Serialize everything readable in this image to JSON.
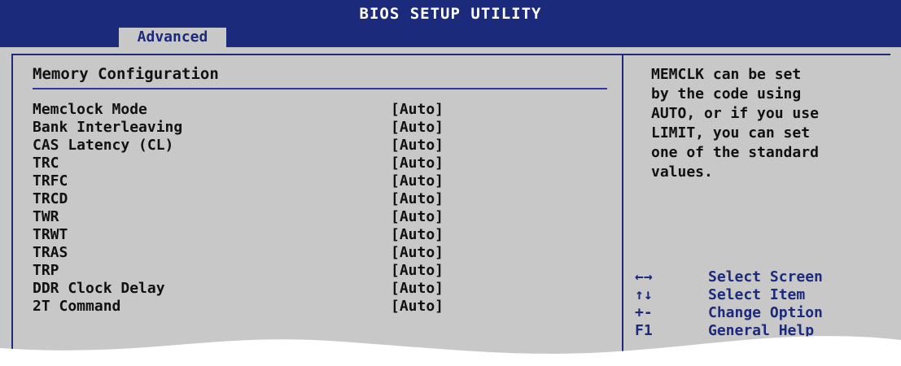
{
  "header": {
    "title": "BIOS SETUP UTILITY",
    "active_tab": "Advanced"
  },
  "main": {
    "section_title": "Memory Configuration",
    "items": [
      {
        "label": "Memclock Mode",
        "value": "[Auto]"
      },
      {
        "label": "Bank Interleaving",
        "value": "[Auto]"
      },
      {
        "label": "CAS Latency (CL)",
        "value": "[Auto]"
      },
      {
        "label": "TRC",
        "value": "[Auto]"
      },
      {
        "label": "TRFC",
        "value": "[Auto]"
      },
      {
        "label": "TRCD",
        "value": "[Auto]"
      },
      {
        "label": "TWR",
        "value": "[Auto]"
      },
      {
        "label": "TRWT",
        "value": "[Auto]"
      },
      {
        "label": "TRAS",
        "value": "[Auto]"
      },
      {
        "label": "TRP",
        "value": "[Auto]"
      },
      {
        "label": "DDR Clock Delay",
        "value": "[Auto]"
      },
      {
        "label": "2T Command",
        "value": "[Auto]"
      }
    ]
  },
  "help_panel": {
    "text": "MEMCLK can be set\nby the code using\nAUTO, or if you use\nLIMIT, you can set\none of the standard\nvalues."
  },
  "keys": [
    {
      "key": "←→",
      "desc": "Select Screen"
    },
    {
      "key": "↑↓",
      "desc": "Select Item"
    },
    {
      "key": "+-",
      "desc": "Change Option"
    },
    {
      "key": "F1",
      "desc": "General Help"
    }
  ],
  "colors": {
    "header_bg": "#1c2a7c",
    "panel_bg": "#c8c8c8",
    "key_text": "#1c2a7c"
  }
}
